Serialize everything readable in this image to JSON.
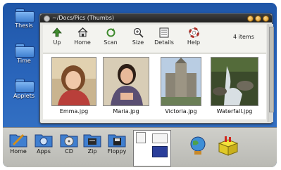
{
  "sidebar": {
    "items": [
      {
        "label": "Thesis"
      },
      {
        "label": "Time"
      },
      {
        "label": "Applets"
      }
    ]
  },
  "window": {
    "title": "~/Docs/Pics (Thumbs)",
    "item_count": "4 items",
    "toolbar": [
      {
        "label": "Up",
        "icon": "up-arrow-icon"
      },
      {
        "label": "Home",
        "icon": "home-icon"
      },
      {
        "label": "Scan",
        "icon": "refresh-icon"
      },
      {
        "label": "Size",
        "icon": "zoom-icon"
      },
      {
        "label": "Details",
        "icon": "details-icon"
      },
      {
        "label": "Help",
        "icon": "help-lifebuoy-icon"
      }
    ],
    "files": [
      {
        "name": "Emma.jpg"
      },
      {
        "name": "Maria.jpg"
      },
      {
        "name": "Victoria.jpg"
      },
      {
        "name": "Waterfall.jpg"
      }
    ]
  },
  "panel": {
    "launchers": [
      {
        "label": "Home",
        "icon": "home-folder-icon"
      },
      {
        "label": "Apps",
        "icon": "apps-folder-icon"
      },
      {
        "label": "CD",
        "icon": "cd-icon"
      },
      {
        "label": "Zip",
        "icon": "zip-icon"
      },
      {
        "label": "Floppy",
        "icon": "floppy-icon"
      }
    ]
  },
  "colors": {
    "desktop": "#2b67bd",
    "titlebar": "#2a2a2a",
    "window_bg": "#e7e7e3",
    "panel_bg": "#c4c4be"
  }
}
